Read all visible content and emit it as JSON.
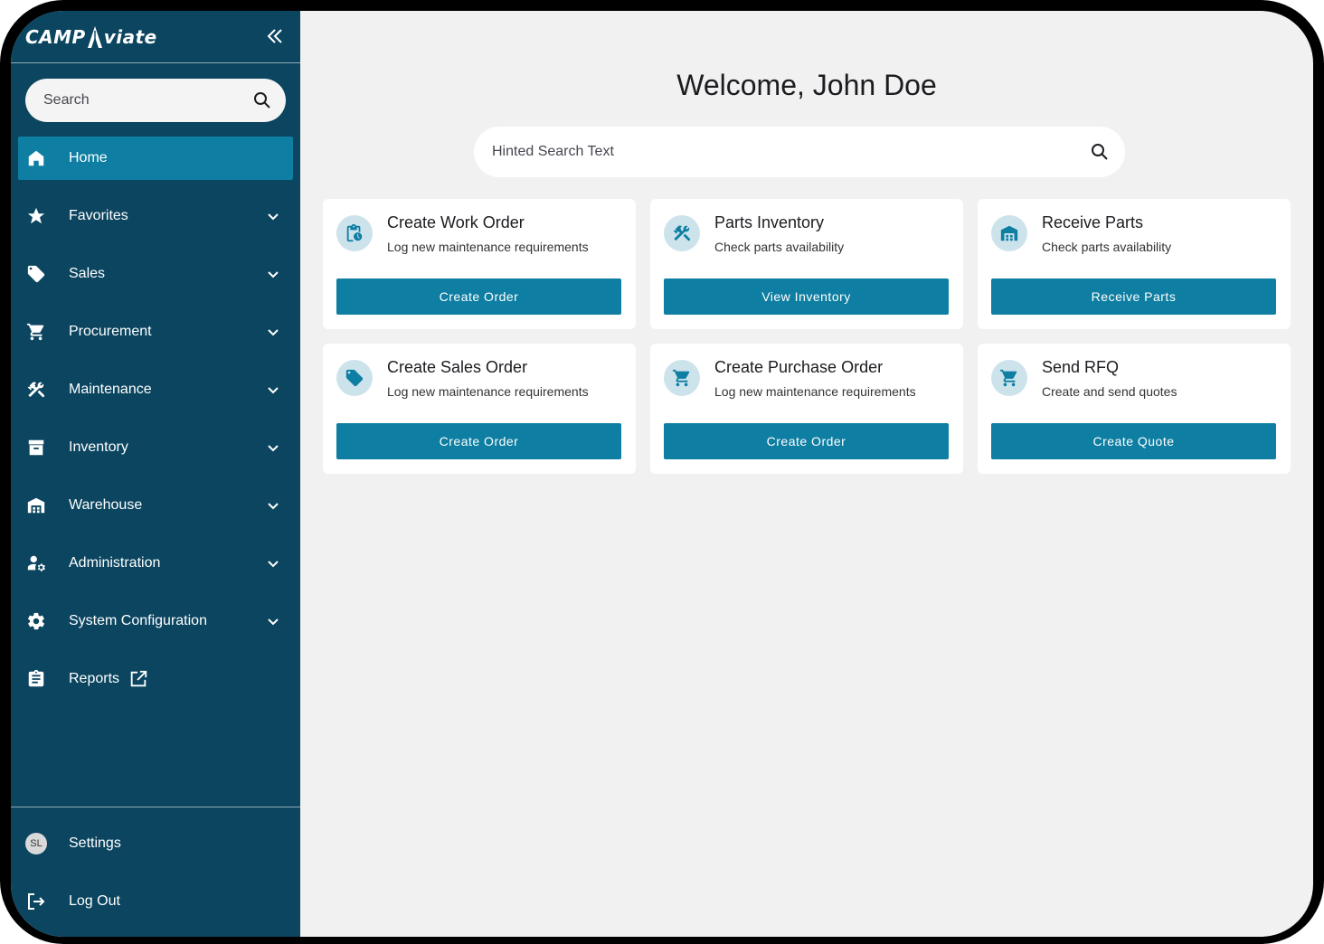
{
  "app": {
    "logo_left": "CAMP",
    "logo_right": "viate"
  },
  "sidebar": {
    "search_placeholder": "Search",
    "items": [
      {
        "label": "Home",
        "icon": "home-icon",
        "active": true,
        "expandable": false
      },
      {
        "label": "Favorites",
        "icon": "star-icon",
        "expandable": true
      },
      {
        "label": "Sales",
        "icon": "tag-icon",
        "expandable": true
      },
      {
        "label": "Procurement",
        "icon": "cart-icon",
        "expandable": true
      },
      {
        "label": "Maintenance",
        "icon": "tools-icon",
        "expandable": true
      },
      {
        "label": "Inventory",
        "icon": "archive-icon",
        "expandable": true
      },
      {
        "label": "Warehouse",
        "icon": "warehouse-icon",
        "expandable": true
      },
      {
        "label": "Administration",
        "icon": "admin-icon",
        "expandable": true
      },
      {
        "label": "System Configuration",
        "icon": "gear-icon",
        "expandable": true
      },
      {
        "label": "Reports",
        "icon": "clipboard-icon",
        "expandable": false,
        "external": true
      }
    ],
    "bottom": {
      "avatar_initials": "SL",
      "settings_label": "Settings",
      "logout_label": "Log Out"
    }
  },
  "main": {
    "welcome": "Welcome, John Doe",
    "search_placeholder": "Hinted Search Text",
    "cards": [
      {
        "title": "Create Work Order",
        "subtitle": "Log new maintenance requirements",
        "button": "Create Order",
        "icon": "clipboard-clock-icon"
      },
      {
        "title": "Parts Inventory",
        "subtitle": "Check parts availability",
        "button": "View Inventory",
        "icon": "tools-icon"
      },
      {
        "title": "Receive Parts",
        "subtitle": "Check parts availability",
        "button": "Receive Parts",
        "icon": "warehouse-icon"
      },
      {
        "title": "Create Sales Order",
        "subtitle": "Log new maintenance requirements",
        "button": "Create Order",
        "icon": "tag-icon"
      },
      {
        "title": "Create Purchase Order",
        "subtitle": "Log new maintenance requirements",
        "button": "Create Order",
        "icon": "cart-icon"
      },
      {
        "title": "Send RFQ",
        "subtitle": "Create and send quotes",
        "button": "Create Quote",
        "icon": "cart-icon"
      }
    ]
  },
  "colors": {
    "sidebar": "#0b4560",
    "accent": "#0e7ea2",
    "icon_bg": "#cde3ec",
    "main_bg": "#f1f1f1"
  }
}
